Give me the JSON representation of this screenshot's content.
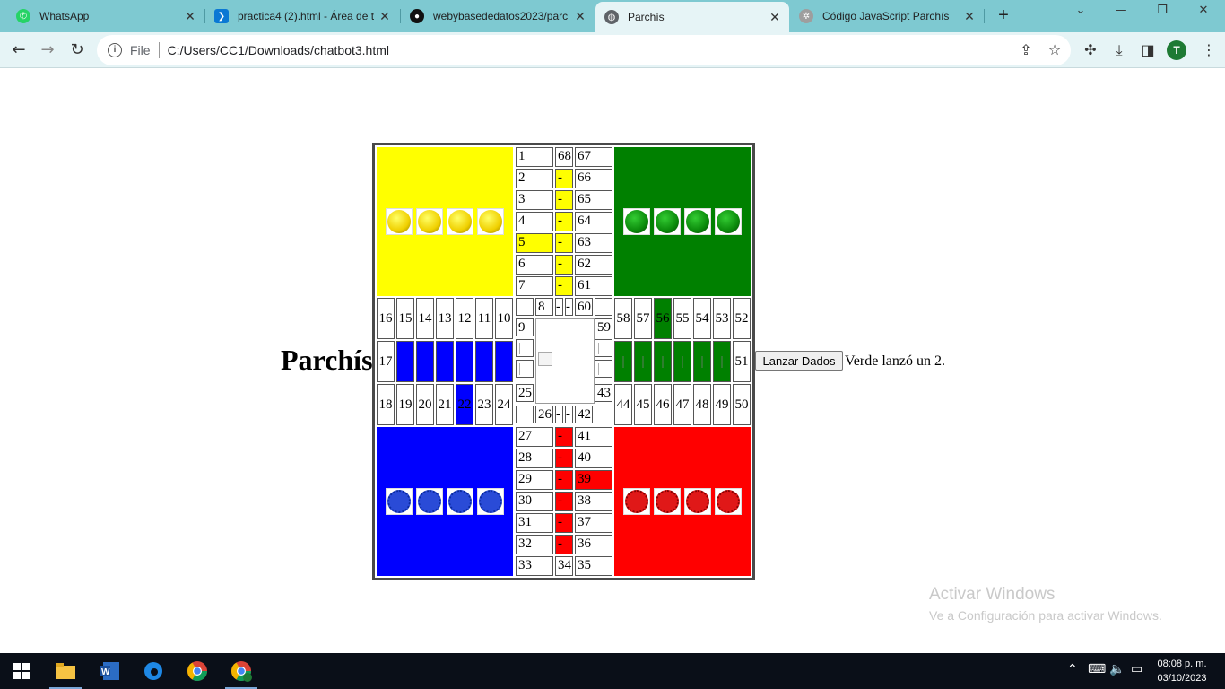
{
  "browser": {
    "tabs": [
      {
        "title": "WhatsApp",
        "icon": "whatsapp-icon",
        "active": false
      },
      {
        "title": "practica4 (2).html - Área de t",
        "icon": "vscode-icon",
        "active": false
      },
      {
        "title": "webybasededatos2023/parc",
        "icon": "github-icon",
        "active": false
      },
      {
        "title": "Parchís",
        "icon": "globe-icon",
        "active": true
      },
      {
        "title": "Código JavaScript Parchís",
        "icon": "openai-icon",
        "active": false
      }
    ],
    "new_tab": "+",
    "address_scheme": "File",
    "address_url": "C:/Users/CC1/Downloads/chatbot3.html",
    "profile_initial": "T"
  },
  "page": {
    "title": "Parchís",
    "button_label": "Lanzar Dados",
    "status": "Verde lanzó un 2.",
    "colors": {
      "yellow": "#ffff00",
      "green": "#008000",
      "blue": "#0000ff",
      "red": "#ff0000"
    }
  },
  "board": {
    "top_left_column": [
      "1",
      "2",
      "3",
      "4",
      "5",
      "6",
      "7"
    ],
    "top_mid_column": [
      "68",
      "-",
      "-",
      "-",
      "-",
      "-",
      "-"
    ],
    "top_right_column": [
      "67",
      "66",
      "65",
      "64",
      "63",
      "62",
      "61"
    ],
    "left_row_top": [
      "16",
      "15",
      "14",
      "13",
      "12",
      "11",
      "10"
    ],
    "left_row_mid_first": "17",
    "left_row_bottom": [
      "18",
      "19",
      "20",
      "21",
      "22",
      "23",
      "24"
    ],
    "center_top": [
      "8",
      "-",
      "-",
      "60"
    ],
    "center_left": [
      "9",
      "|",
      "|",
      "25"
    ],
    "center_right": [
      "59",
      "|",
      "|",
      "43"
    ],
    "center_bottom": [
      "26",
      "-",
      "-",
      "42"
    ],
    "right_row_top": [
      "58",
      "57",
      "56",
      "55",
      "54",
      "53",
      "52"
    ],
    "right_row_mid": [
      "|",
      "|",
      "|",
      "|",
      "|",
      "|",
      "51"
    ],
    "right_row_bottom": [
      "44",
      "45",
      "46",
      "47",
      "48",
      "49",
      "50"
    ],
    "bottom_left_column": [
      "27",
      "28",
      "29",
      "30",
      "31",
      "32",
      "33"
    ],
    "bottom_mid_column": [
      "-",
      "-",
      "-",
      "-",
      "-",
      "-",
      "34"
    ],
    "bottom_right_column": [
      "41",
      "40",
      "39",
      "38",
      "37",
      "36",
      "35"
    ]
  },
  "watermark": {
    "line1": "Activar Windows",
    "line2": "Ve a Configuración para activar Windows."
  },
  "taskbar": {
    "time": "08:08 p. m.",
    "date": "03/10/2023"
  }
}
